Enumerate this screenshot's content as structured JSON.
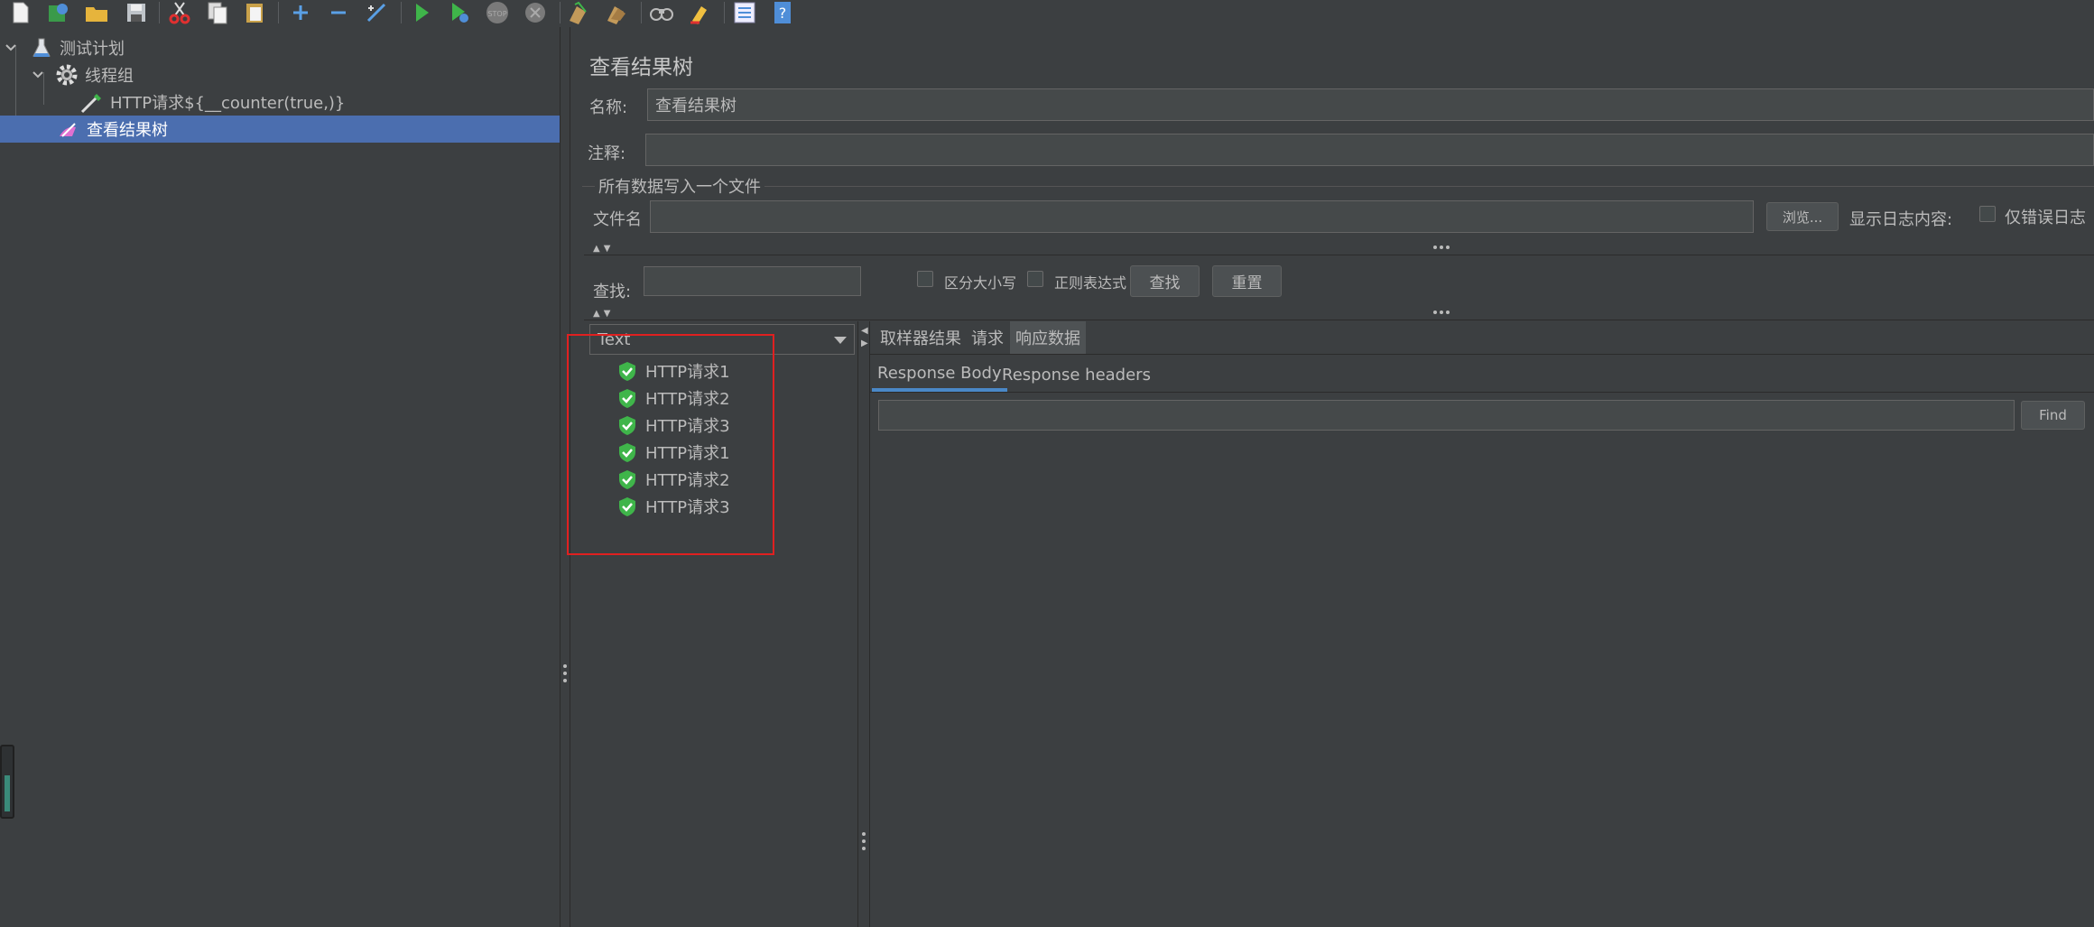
{
  "toolbar": {
    "icons": [
      "new-file-icon",
      "templates-icon",
      "open-icon",
      "save-icon",
      "cut-icon",
      "copy-icon",
      "paste-icon",
      "expand-icon",
      "collapse-icon",
      "toggle-icon",
      "start-icon",
      "start-no-pause-icon",
      "stop-icon",
      "shutdown-icon",
      "clear-icon",
      "clear-all-icon",
      "search-icon",
      "reset-search-icon",
      "function-helper-icon",
      "help-icon"
    ]
  },
  "tree": {
    "items": [
      {
        "label": "测试计划",
        "icon": "flask-icon"
      },
      {
        "label": "线程组",
        "icon": "gear-icon"
      },
      {
        "label": "HTTP请求${__counter(true,)}",
        "icon": "pipette-icon"
      },
      {
        "label": "查看结果树",
        "icon": "listener-icon"
      }
    ]
  },
  "panel": {
    "title": "查看结果树",
    "name_label": "名称:",
    "name_value": "查看结果树",
    "comment_label": "注释:",
    "comment_value": "",
    "file_section_title": "所有数据写入一个文件",
    "file_label": "文件名",
    "file_value": "",
    "browse_button": "浏览...",
    "log_content_label": "显示日志内容:",
    "errors_only_label": "仅错误日志"
  },
  "search": {
    "label": "查找:",
    "value": "",
    "case_sensitive_label": "区分大小写",
    "regex_label": "正则表达式",
    "find_button": "查找",
    "reset_button": "重置"
  },
  "results": {
    "renderer_selected": "Text",
    "items": [
      "HTTP请求1",
      "HTTP请求2",
      "HTTP请求3",
      "HTTP请求1",
      "HTTP请求2",
      "HTTP请求3"
    ],
    "status_color": "#3fb54a"
  },
  "detail": {
    "tabs": [
      "取样器结果",
      "请求",
      "响应数据"
    ],
    "active_tab": "响应数据",
    "subtabs": [
      "Response Body",
      "Response headers"
    ],
    "active_subtab": "Response Body",
    "find_value": "",
    "find_button": "Find"
  },
  "annotation": {
    "color": "#e02020"
  }
}
